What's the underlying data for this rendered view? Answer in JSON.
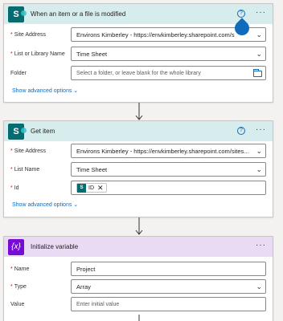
{
  "colors": {
    "sharepoint": "#036c70",
    "variable": "#770bd6",
    "link": "#0f6cbd",
    "required": "#a4262c"
  },
  "cards": [
    {
      "title": "When an item or a file is modified",
      "icon": "sharepoint-icon",
      "icon_text": "S",
      "fields": [
        {
          "label": "Site Address",
          "required": true,
          "value": "Environs Kimberley - https://envkimberley.sharepoint.com/s"
        },
        {
          "label": "List or Library Name",
          "required": true,
          "value": "Time Sheet"
        },
        {
          "label": "Folder",
          "required": false,
          "placeholder": "Select a folder, or leave blank for the whole library"
        }
      ],
      "advanced": "Show advanced options"
    },
    {
      "title": "Get item",
      "icon": "sharepoint-icon",
      "icon_text": "S",
      "fields": [
        {
          "label": "Site Address",
          "required": true,
          "value": "Environs Kimberley - https://envkimberley.sharepoint.com/sites..."
        },
        {
          "label": "List Name",
          "required": true,
          "value": "Time Sheet"
        },
        {
          "label": "Id",
          "required": true,
          "token": "ID"
        }
      ],
      "advanced": "Show advanced options"
    },
    {
      "title": "Initialize variable",
      "icon": "variable-icon",
      "icon_text": "{x}",
      "fields": [
        {
          "label": "Name",
          "required": true,
          "value": "Project"
        },
        {
          "label": "Type",
          "required": true,
          "value": "Array"
        },
        {
          "label": "Value",
          "required": false,
          "placeholder": "Enter initial value"
        }
      ]
    }
  ],
  "help_glyph": "?",
  "more_glyph": "···",
  "token_icon_text": "S",
  "token_close": "✕",
  "required_mark": "*",
  "chevron": "⌄",
  "adv_chevron": "⌄"
}
